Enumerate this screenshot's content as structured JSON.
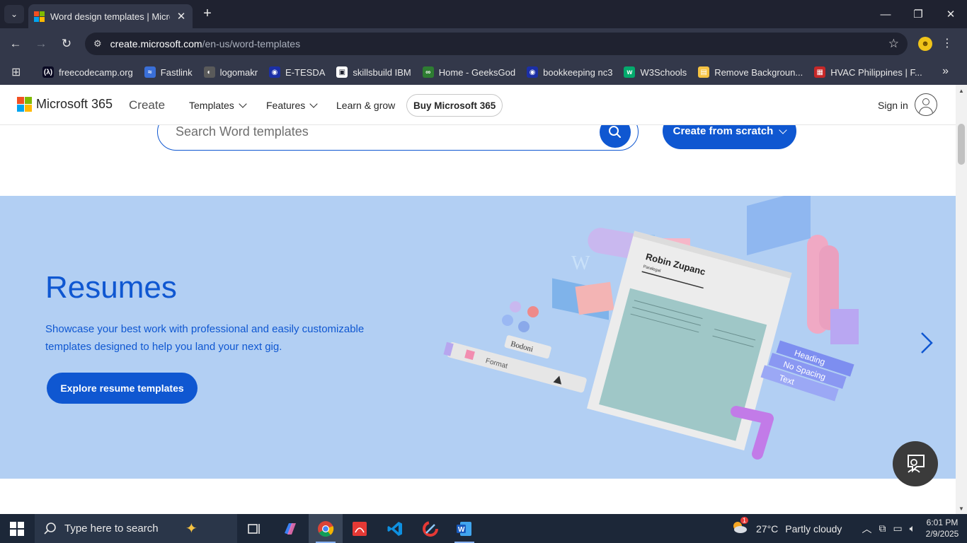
{
  "browser": {
    "tab": {
      "title": "Word design templates | Micros",
      "close": "✕"
    },
    "new_tab": "+",
    "window_controls": {
      "minimize": "—",
      "restore": "❐",
      "close": "✕"
    },
    "url": {
      "host": "create.microsoft.com",
      "path": "/en-us/word-templates"
    },
    "bookmarks": [
      {
        "label": "freecodecamp.org",
        "icon": "fcc-icon",
        "color": "#0a0a23",
        "glyph": "(λ)"
      },
      {
        "label": "Fastlink",
        "icon": "fastlink-icon",
        "color": "#3a6fd8",
        "glyph": "≈"
      },
      {
        "label": "logomakr",
        "icon": "logomakr-icon",
        "color": "#5a5a5a",
        "glyph": "◐"
      },
      {
        "label": "E-TESDA",
        "icon": "etesda-icon",
        "color": "#1b2fa6",
        "glyph": "◉"
      },
      {
        "label": "skillsbuild IBM",
        "icon": "skillsbuild-icon",
        "color": "#ffffff",
        "glyph": "▣"
      },
      {
        "label": "Home - GeeksGod",
        "icon": "geeksgod-icon",
        "color": "#2e7d32",
        "glyph": "∞"
      },
      {
        "label": "bookkeeping nc3",
        "icon": "bookkeeping-icon",
        "color": "#1b2fa6",
        "glyph": "◉"
      },
      {
        "label": "W3Schools",
        "icon": "w3schools-icon",
        "color": "#04aa6d",
        "glyph": "w"
      },
      {
        "label": "Remove Backgroun...",
        "icon": "removebg-icon",
        "color": "#f5c242",
        "glyph": "▤"
      },
      {
        "label": "HVAC Philippines | F...",
        "icon": "hvac-icon",
        "color": "#c62828",
        "glyph": "▦"
      }
    ]
  },
  "site": {
    "brand": "Microsoft 365",
    "create": "Create",
    "nav": [
      {
        "label": "Templates",
        "dropdown": true
      },
      {
        "label": "Features",
        "dropdown": true
      },
      {
        "label": "Learn & grow",
        "dropdown": false
      }
    ],
    "buy": "Buy Microsoft 365",
    "signin": "Sign in",
    "search_placeholder": "Search Word templates",
    "create_scratch": "Create from scratch"
  },
  "hero": {
    "title": "Resumes",
    "description": "Showcase your best work with professional and easily customizable templates designed to help you land your next gig.",
    "button": "Explore resume templates",
    "art": {
      "doc_name": "Robin Zupanc",
      "doc_role": "Paralegal",
      "tiles": [
        "Heading",
        "No Spacing",
        "Text"
      ],
      "font_chip": "Bodoni",
      "toolbar_label": "Format"
    },
    "colors": {
      "background": "#b2cff3",
      "accent": "#0f57d1"
    }
  },
  "taskbar": {
    "search_placeholder": "Type here to search",
    "weather": {
      "temp": "27°C",
      "condition": "Partly cloudy"
    },
    "time": "6:01 PM",
    "date": "2/9/2025",
    "notification_count": "1"
  }
}
